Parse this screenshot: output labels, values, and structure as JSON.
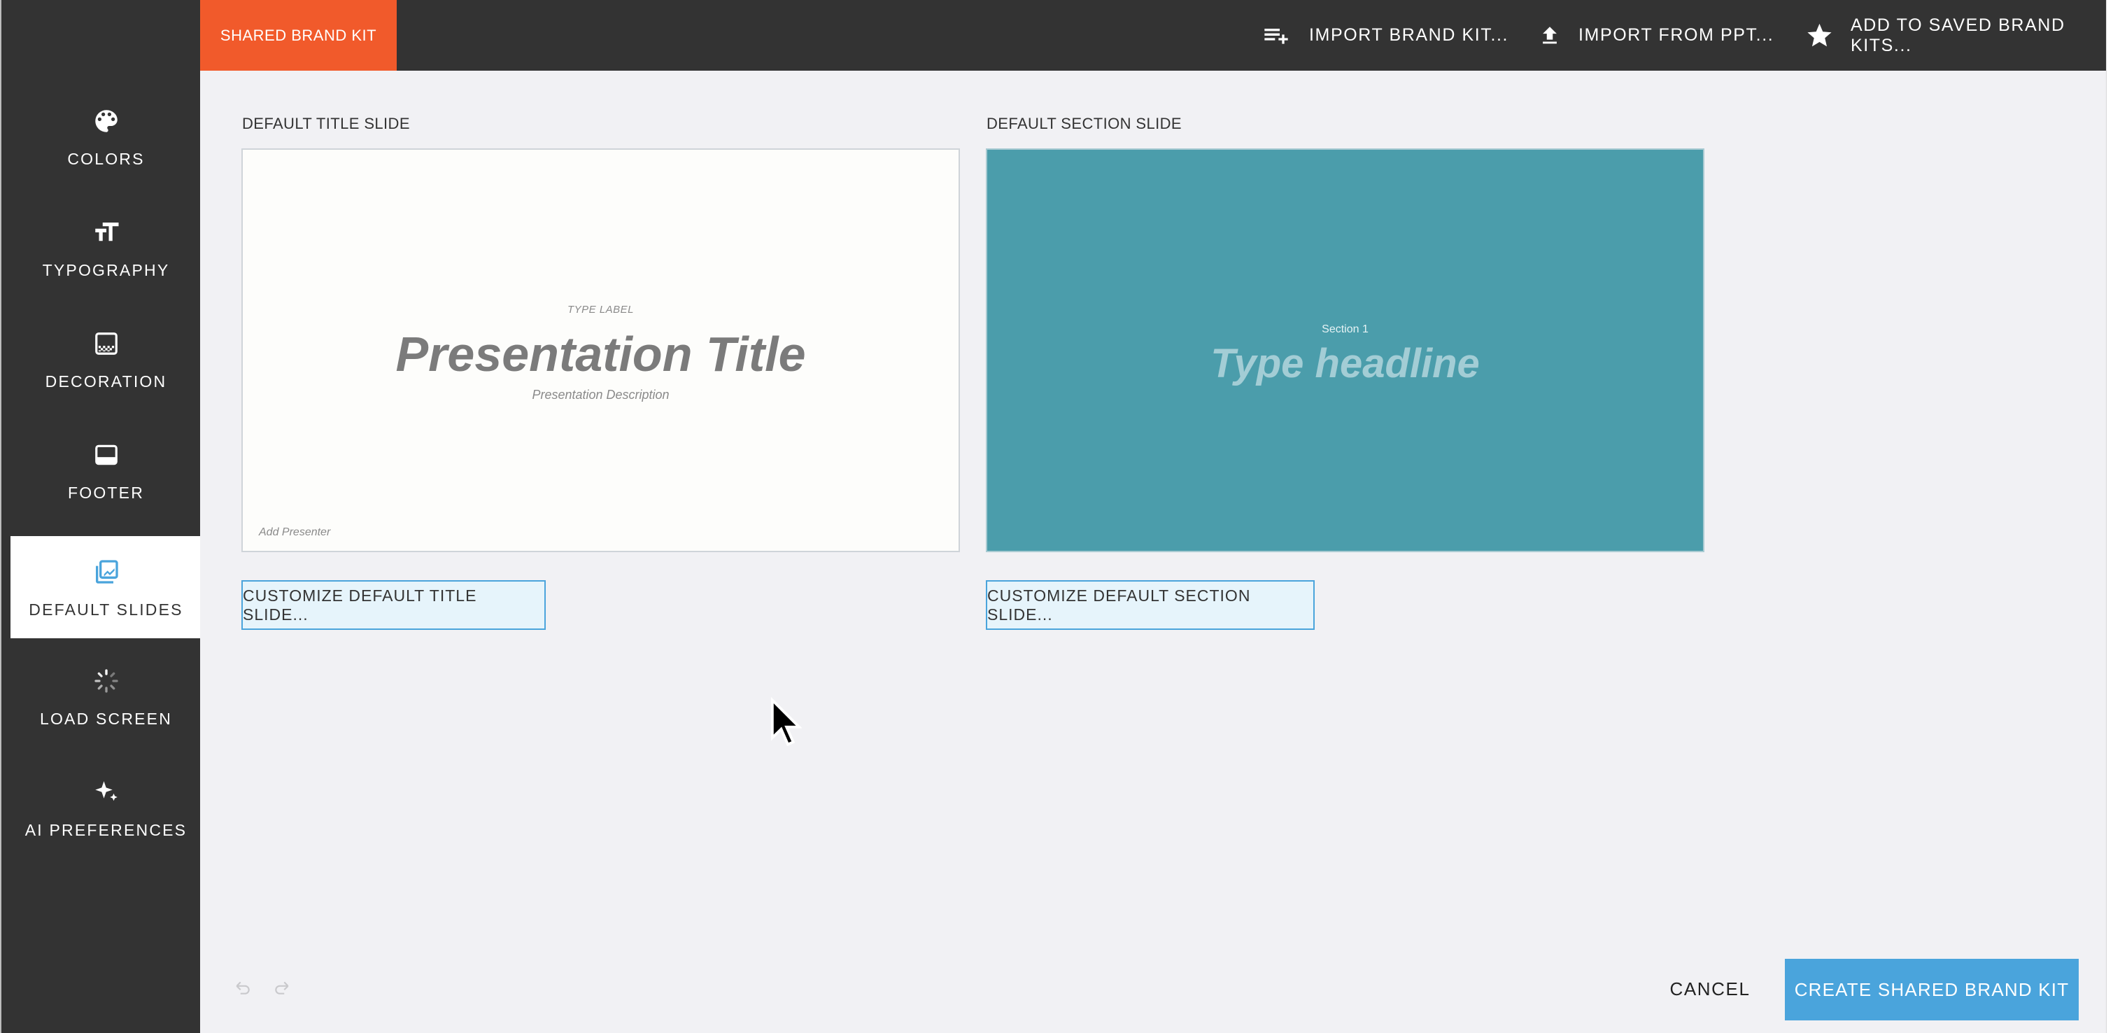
{
  "sidebar": {
    "items": [
      {
        "label": "COLORS",
        "icon": "palette-icon"
      },
      {
        "label": "TYPOGRAPHY",
        "icon": "text-size-icon"
      },
      {
        "label": "DECORATION",
        "icon": "decoration-icon"
      },
      {
        "label": "FOOTER",
        "icon": "footer-icon"
      },
      {
        "label": "DEFAULT SLIDES",
        "icon": "default-slides-icon",
        "active": true
      },
      {
        "label": "LOAD SCREEN",
        "icon": "spinner-icon"
      },
      {
        "label": "AI PREFERENCES",
        "icon": "sparkle-icon"
      }
    ]
  },
  "topbar": {
    "tab_label": "SHARED BRAND KIT",
    "actions": [
      {
        "label": "IMPORT BRAND KIT...",
        "icon": "playlist-add-icon"
      },
      {
        "label": "IMPORT FROM PPT...",
        "icon": "upload-icon"
      },
      {
        "label": "ADD TO SAVED BRAND KITS...",
        "icon": "star-icon"
      }
    ]
  },
  "main": {
    "title_slide": {
      "heading": "DEFAULT TITLE SLIDE",
      "type_label": "TYPE LABEL",
      "title": "Presentation Title",
      "description": "Presentation Description",
      "presenter": "Add Presenter",
      "button_label": "CUSTOMIZE DEFAULT TITLE SLIDE..."
    },
    "section_slide": {
      "heading": "DEFAULT SECTION SLIDE",
      "label": "Section 1",
      "headline": "Type headline",
      "button_label": "CUSTOMIZE DEFAULT SECTION SLIDE..."
    }
  },
  "footer": {
    "cancel_label": "CANCEL",
    "create_label": "CREATE SHARED BRAND KIT"
  },
  "colors": {
    "accent_orange": "#f15a2b",
    "accent_blue": "#4aa4dc",
    "section_slide_bg": "#4b9dab",
    "sidebar_bg": "#333333"
  }
}
